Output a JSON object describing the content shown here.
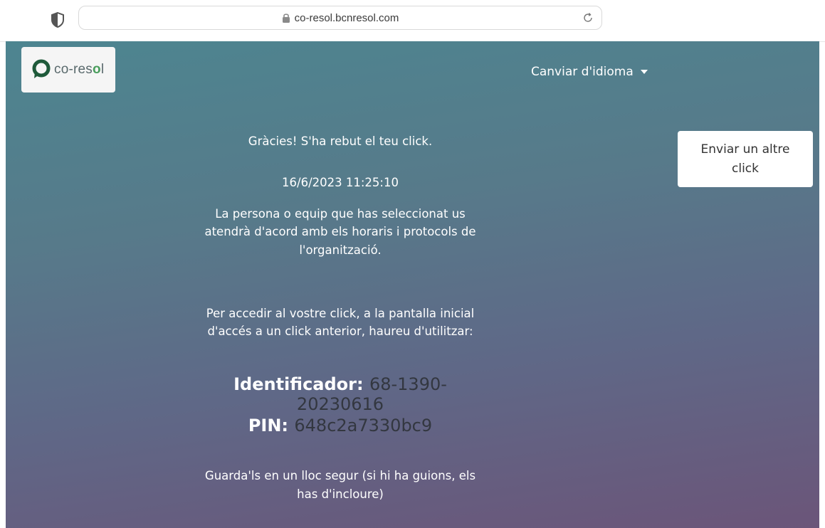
{
  "browser": {
    "url": "co-resol.bcnresol.com"
  },
  "header": {
    "logo_text_prefix": "co-res",
    "logo_text_o": "o",
    "logo_text_suffix": "l",
    "language_menu": "Canviar d'idioma"
  },
  "main": {
    "thanks": "Gràcies! S'ha rebut el teu click.",
    "timestamp": "16/6/2023 11:25:10",
    "info_line1": "La persona o equip que has seleccionat us",
    "info_line2": "atendrà d'acord amb els horaris i protocols de",
    "info_line3": "l'organització.",
    "access_line1": "Per accedir al vostre click, a la pantalla inicial",
    "access_line2": "d'accés a un click anterior, haureu d'utilitzar:",
    "identifier_label": "Identificador:",
    "identifier_value_part1": "68-1390-",
    "identifier_value_part2": "20230616",
    "pin_label": "PIN:",
    "pin_value": "648c2a7330bc9",
    "save_line1": "Guarda'ls en un lloc segur (si hi ha guions, els",
    "save_line2": "has d'incloure)"
  },
  "actions": {
    "send_another_line1": "Enviar un altre",
    "send_another_line2": "click"
  },
  "colors": {
    "gradient_top": "#4d8590",
    "gradient_bottom": "#6b5579",
    "logo_accent": "#4a9e5d"
  }
}
